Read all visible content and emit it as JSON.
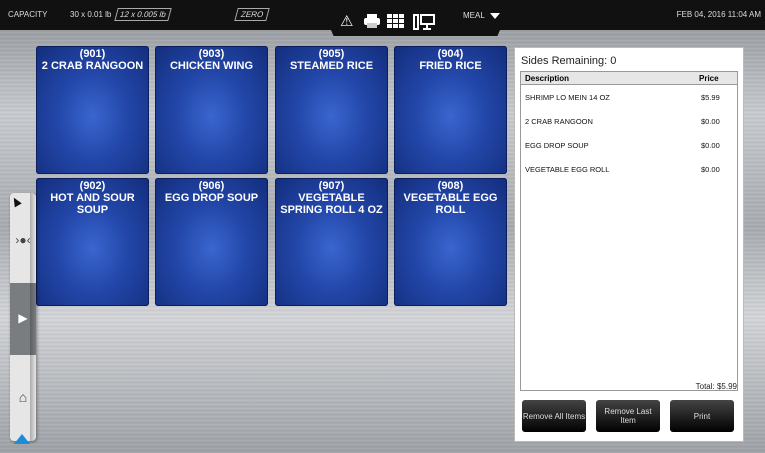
{
  "topbar": {
    "capacity_label": "CAPACITY",
    "capacity_value": "30 x 0.01 lb",
    "resolution": "12 x 0.005 lb",
    "zero_label": "ZERO",
    "date": "FEB 04, 2016 11:04 AM"
  },
  "tab": {
    "meal_label": "MEAL",
    "icons": [
      "warning-icon",
      "printer-icon",
      "grid-icon",
      "workstation-icon"
    ]
  },
  "tiles": [
    {
      "code": "(901)",
      "name": "2 CRAB RANGOON"
    },
    {
      "code": "(903)",
      "name": "CHICKEN WING"
    },
    {
      "code": "(905)",
      "name": "STEAMED RICE"
    },
    {
      "code": "(904)",
      "name": "FRIED RICE"
    },
    {
      "code": "(902)",
      "name": "HOT AND SOUR SOUP"
    },
    {
      "code": "(906)",
      "name": "EGG DROP SOUP"
    },
    {
      "code": "(907)",
      "name": "VEGETABLE SPRING ROLL 4 OZ"
    },
    {
      "code": "(908)",
      "name": "VEGETABLE EGG ROLL"
    }
  ],
  "order": {
    "sides_remaining": "Sides Remaining: 0",
    "columns": [
      "Description",
      "Price"
    ],
    "rows": [
      {
        "description": "SHRIMP LO MEIN 14 OZ",
        "price": "$5.99"
      },
      {
        "description": "2 CRAB RANGOON",
        "price": "$0.00"
      },
      {
        "description": "EGG DROP SOUP",
        "price": "$0.00"
      },
      {
        "description": "VEGETABLE EGG ROLL",
        "price": "$0.00"
      }
    ],
    "total": "Total:  $5.99",
    "buttons": {
      "remove_all": "Remove All Items",
      "remove_last": "Remove Last Item",
      "print": "Print"
    }
  },
  "colors": {
    "tile": "#2246a8",
    "accent": "#1e8bd6"
  }
}
